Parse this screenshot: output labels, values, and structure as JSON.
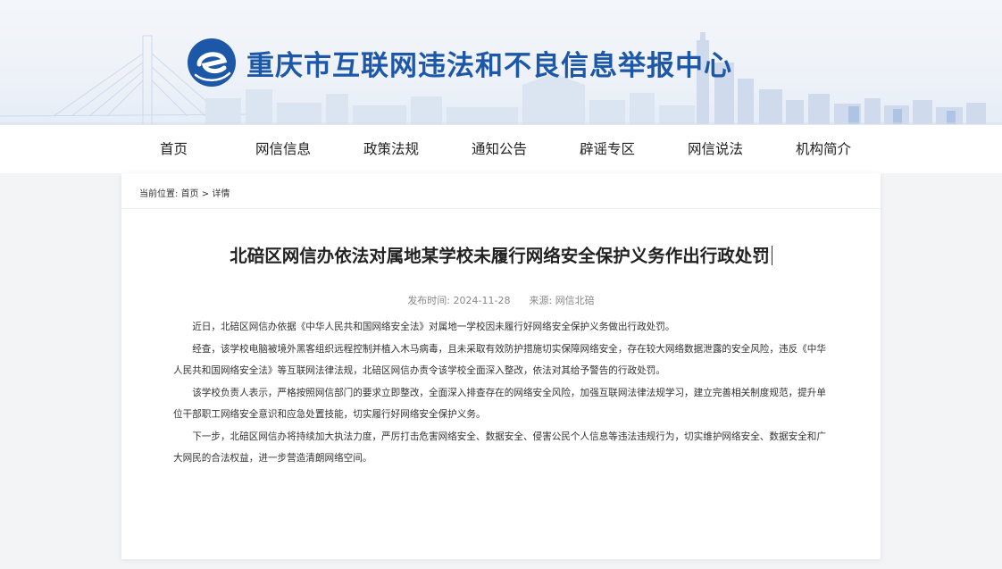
{
  "header": {
    "site_title": "重庆市互联网违法和不良信息举报中心",
    "logo_icon": "e-logo-icon",
    "brand_color": "#1c57a8"
  },
  "nav": {
    "items": [
      {
        "label": "首页"
      },
      {
        "label": "网信信息"
      },
      {
        "label": "政策法规"
      },
      {
        "label": "通知公告"
      },
      {
        "label": "辟谣专区"
      },
      {
        "label": "网信说法"
      },
      {
        "label": "机构简介"
      }
    ]
  },
  "breadcrumb": {
    "prefix": "当前位置:",
    "home": "首页",
    "separator": ">",
    "current": "详情"
  },
  "article": {
    "title": "北碚区网信办依法对属地某学校未履行网络安全保护义务作出行政处罚",
    "date_label": "发布时间:",
    "date": "2024-11-28",
    "source_label": "来源:",
    "source": "网信北碚",
    "paragraphs": [
      "近日，北碚区网信办依据《中华人民共和国网络安全法》对属地一学校因未履行好网络安全保护义务做出行政处罚。",
      "经查，该学校电脑被境外黑客组织远程控制并植入木马病毒，且未采取有效防护措施切实保障网络安全，存在较大网络数据泄露的安全风险，违反《中华人民共和国网络安全法》等互联网法律法规，北碚区网信办责令该学校全面深入整改，依法对其给予警告的行政处罚。",
      "该学校负责人表示，严格按照网信部门的要求立即整改，全面深入排查存在的网络安全风险，加强互联网法律法规学习，建立完善相关制度规范，提升单位干部职工网络安全意识和应急处置技能，切实履行好网络安全保护义务。",
      "下一步，北碚区网信办将持续加大执法力度，严厉打击危害网络安全、数据安全、侵害公民个人信息等违法违规行为，切实维护网络安全、数据安全和广大网民的合法权益，进一步营造清朗网络空间。"
    ]
  }
}
